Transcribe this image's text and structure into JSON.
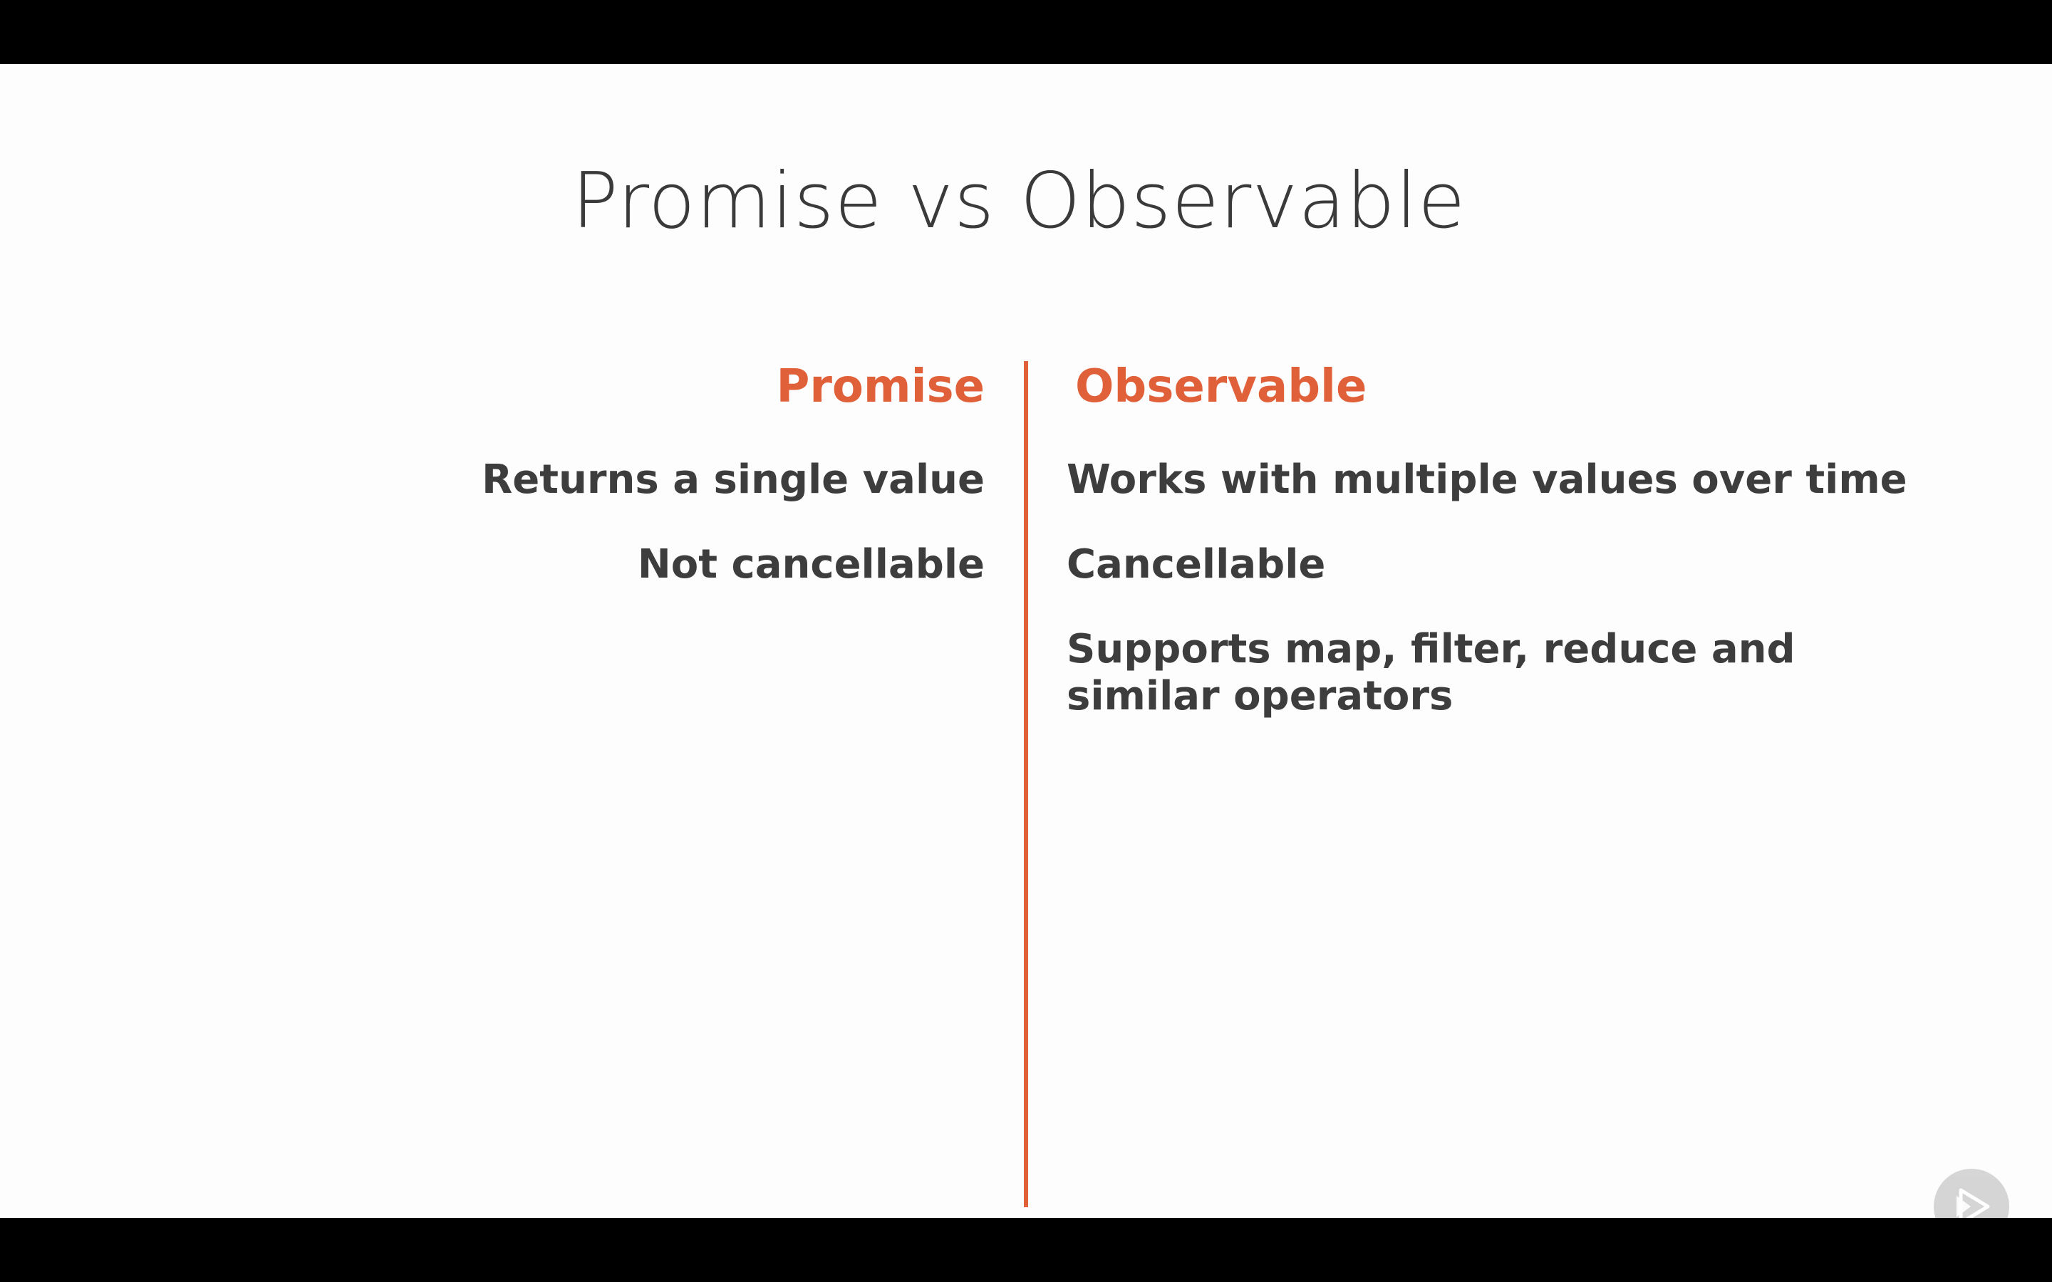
{
  "slide": {
    "title": "Promise vs Observable",
    "accent_color": "#e0603a",
    "text_color": "#3d3d3d",
    "left_column": {
      "header": "Promise",
      "items": [
        "Returns a single value",
        "Not cancellable"
      ]
    },
    "right_column": {
      "header": "Observable",
      "items": [
        "Works with multiple values over time",
        "Cancellable",
        "Supports map, filter, reduce and similar operators"
      ]
    }
  },
  "badge": {
    "icon": "play-logo-icon"
  }
}
